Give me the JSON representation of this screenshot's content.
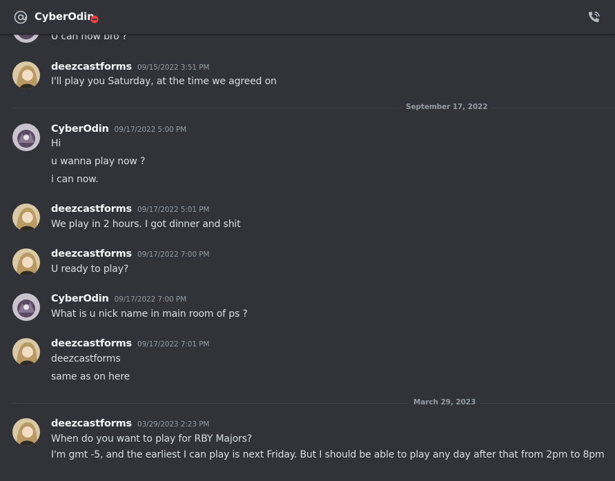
{
  "header": {
    "channel_name": "CyberOdin",
    "status_icon": "dnd-status-icon",
    "channel_icon": "at-sign-icon",
    "call_icon": "phone-call-icon"
  },
  "colors": {
    "background": "#313338",
    "text": "#dbdee1",
    "username": "#f2f3f5",
    "muted": "#949ba4",
    "dnd": "#f23f43"
  },
  "messages": {
    "partial": {
      "text": "U can now bro ?"
    },
    "m1": {
      "author": "deezcastforms",
      "time": "09/15/2022 3:51 PM",
      "lines": [
        "I'll play you Saturday, at the time we agreed on"
      ]
    },
    "div1": {
      "label": "September 17, 2022"
    },
    "m2": {
      "author": "CyberOdin",
      "time": "09/17/2022 5:00 PM",
      "lines": [
        "Hi",
        "u wanna play now ?",
        "i can now."
      ]
    },
    "m3": {
      "author": "deezcastforms",
      "time": "09/17/2022 5:01 PM",
      "lines": [
        "We play in 2 hours. I got dinner and shit"
      ]
    },
    "m4": {
      "author": "deezcastforms",
      "time": "09/17/2022 7:00 PM",
      "lines": [
        "U ready to play?"
      ]
    },
    "m5": {
      "author": "CyberOdin",
      "time": "09/17/2022 7:00 PM",
      "lines": [
        "What is u nick name in main room of ps ?"
      ]
    },
    "m6": {
      "author": "deezcastforms",
      "time": "09/17/2022 7:01 PM",
      "lines": [
        "deezcastforms",
        "same as on here"
      ]
    },
    "div2": {
      "label": "March 29, 2023"
    },
    "m7": {
      "author": "deezcastforms",
      "time": "03/29/2023 2:23 PM",
      "lines": [
        "When do you want to play for RBY Majors?",
        "I'm gmt -5, and the earliest I can play is next Friday. But I should be able to play any day after that from 2pm to 8pm"
      ]
    }
  }
}
